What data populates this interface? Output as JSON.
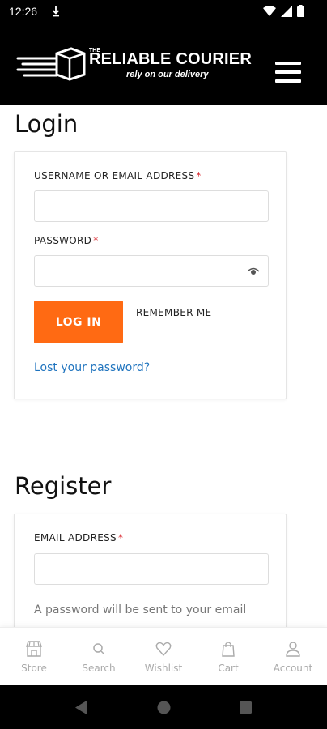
{
  "status_bar": {
    "time": "12:26"
  },
  "header": {
    "logo_the": "THE",
    "logo_title": "RELIABLE COURIER",
    "logo_tagline": "rely on our delivery"
  },
  "login": {
    "title": "Login",
    "username_label": "USERNAME OR EMAIL ADDRESS",
    "username_value": "",
    "password_label": "PASSWORD",
    "password_value": "",
    "required_mark": "*",
    "login_button": "LOG IN",
    "remember_label": "REMEMBER ME",
    "lost_password": "Lost your password?"
  },
  "register": {
    "title": "Register",
    "email_label": "EMAIL ADDRESS",
    "email_value": "",
    "required_mark": "*",
    "help_text": "A password will be sent to your email"
  },
  "bottom_nav": [
    {
      "label": "Store",
      "icon": "store-icon"
    },
    {
      "label": "Search",
      "icon": "search-icon"
    },
    {
      "label": "Wishlist",
      "icon": "heart-icon"
    },
    {
      "label": "Cart",
      "icon": "bag-icon"
    },
    {
      "label": "Account",
      "icon": "user-icon"
    }
  ],
  "colors": {
    "accent": "#ff6a13",
    "link": "#1e73be",
    "required": "#d9272e",
    "header_bg": "#000000"
  }
}
